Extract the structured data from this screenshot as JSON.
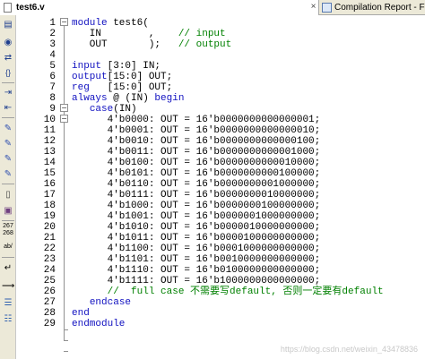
{
  "tabs": {
    "active": "test6.v",
    "inactive": "Compilation Report - Flow Summ"
  },
  "toolbar": {
    "buttons": [
      "open-icon",
      "binoculars-icon",
      "replace-icon",
      "brace-icon",
      "indent-icon",
      "unindent-icon",
      "bookmark-toggle-icon",
      "bookmark-next-icon",
      "bookmark-prev-icon",
      "bookmark-clear-icon",
      "insert-template-icon",
      "insert-file-icon",
      "line-numbers-icon",
      "abc-icon",
      "wrap-icon",
      "list-icon"
    ],
    "line_num_label_1": "267",
    "line_num_label_2": "268",
    "abc_label": "ab/"
  },
  "editor": {
    "line_numbers": [
      "1",
      "2",
      "3",
      "4",
      "5",
      "6",
      "7",
      "8",
      "9",
      "10",
      "11",
      "12",
      "13",
      "14",
      "15",
      "16",
      "17",
      "18",
      "19",
      "20",
      "21",
      "22",
      "23",
      "24",
      "25",
      "26",
      "27",
      "28",
      "29"
    ],
    "lines": [
      [
        {
          "t": "module",
          "k": "kw"
        },
        {
          "t": " test6(",
          "k": ""
        }
      ],
      [
        {
          "t": "   IN        ,    ",
          "k": ""
        },
        {
          "t": "// input",
          "k": "cm"
        }
      ],
      [
        {
          "t": "   OUT       );   ",
          "k": ""
        },
        {
          "t": "// output",
          "k": "cm"
        }
      ],
      [],
      [
        {
          "t": "input",
          "k": "kw"
        },
        {
          "t": " [3:0] IN;",
          "k": ""
        }
      ],
      [
        {
          "t": "output",
          "k": "kw"
        },
        {
          "t": "[15:0] OUT;",
          "k": ""
        }
      ],
      [
        {
          "t": "reg",
          "k": "kw"
        },
        {
          "t": "   [15:0] OUT;",
          "k": ""
        }
      ],
      [
        {
          "t": "always",
          "k": "kw"
        },
        {
          "t": " @ (IN) ",
          "k": ""
        },
        {
          "t": "begin",
          "k": "kw"
        }
      ],
      [
        {
          "t": "   ",
          "k": ""
        },
        {
          "t": "case",
          "k": "kw"
        },
        {
          "t": "(IN)",
          "k": ""
        }
      ],
      [
        {
          "t": "      4'b0000: OUT = 16'b0000000000000001;",
          "k": ""
        }
      ],
      [
        {
          "t": "      4'b0001: OUT = 16'b0000000000000010;",
          "k": ""
        }
      ],
      [
        {
          "t": "      4'b0010: OUT = 16'b0000000000000100;",
          "k": ""
        }
      ],
      [
        {
          "t": "      4'b0011: OUT = 16'b0000000000001000;",
          "k": ""
        }
      ],
      [
        {
          "t": "      4'b0100: OUT = 16'b0000000000010000;",
          "k": ""
        }
      ],
      [
        {
          "t": "      4'b0101: OUT = 16'b0000000000100000;",
          "k": ""
        }
      ],
      [
        {
          "t": "      4'b0110: OUT = 16'b0000000001000000;",
          "k": ""
        }
      ],
      [
        {
          "t": "      4'b0111: OUT = 16'b0000000010000000;",
          "k": ""
        }
      ],
      [
        {
          "t": "      4'b1000: OUT = 16'b0000000100000000;",
          "k": ""
        }
      ],
      [
        {
          "t": "      4'b1001: OUT = 16'b0000001000000000;",
          "k": ""
        }
      ],
      [
        {
          "t": "      4'b1010: OUT = 16'b0000010000000000;",
          "k": ""
        }
      ],
      [
        {
          "t": "      4'b1011: OUT = 16'b0000100000000000;",
          "k": ""
        }
      ],
      [
        {
          "t": "      4'b1100: OUT = 16'b0001000000000000;",
          "k": ""
        }
      ],
      [
        {
          "t": "      4'b1101: OUT = 16'b0010000000000000;",
          "k": ""
        }
      ],
      [
        {
          "t": "      4'b1110: OUT = 16'b0100000000000000;",
          "k": ""
        }
      ],
      [
        {
          "t": "      4'b1111: OUT = 16'b1000000000000000;",
          "k": ""
        }
      ],
      [
        {
          "t": "      ",
          "k": ""
        },
        {
          "t": "//  full case 不需要写default, 否则一定要有default",
          "k": "cm"
        }
      ],
      [
        {
          "t": "   ",
          "k": ""
        },
        {
          "t": "endcase",
          "k": "kw"
        }
      ],
      [
        {
          "t": "end",
          "k": "kw"
        }
      ],
      [
        {
          "t": "endmodule",
          "k": "kw"
        }
      ]
    ]
  },
  "watermark": "https://blog.csdn.net/weixin_43478836",
  "colors": {
    "keyword": "#1010c0",
    "comment": "#008000",
    "text": "#000000",
    "chrome": "#ece9d8"
  }
}
